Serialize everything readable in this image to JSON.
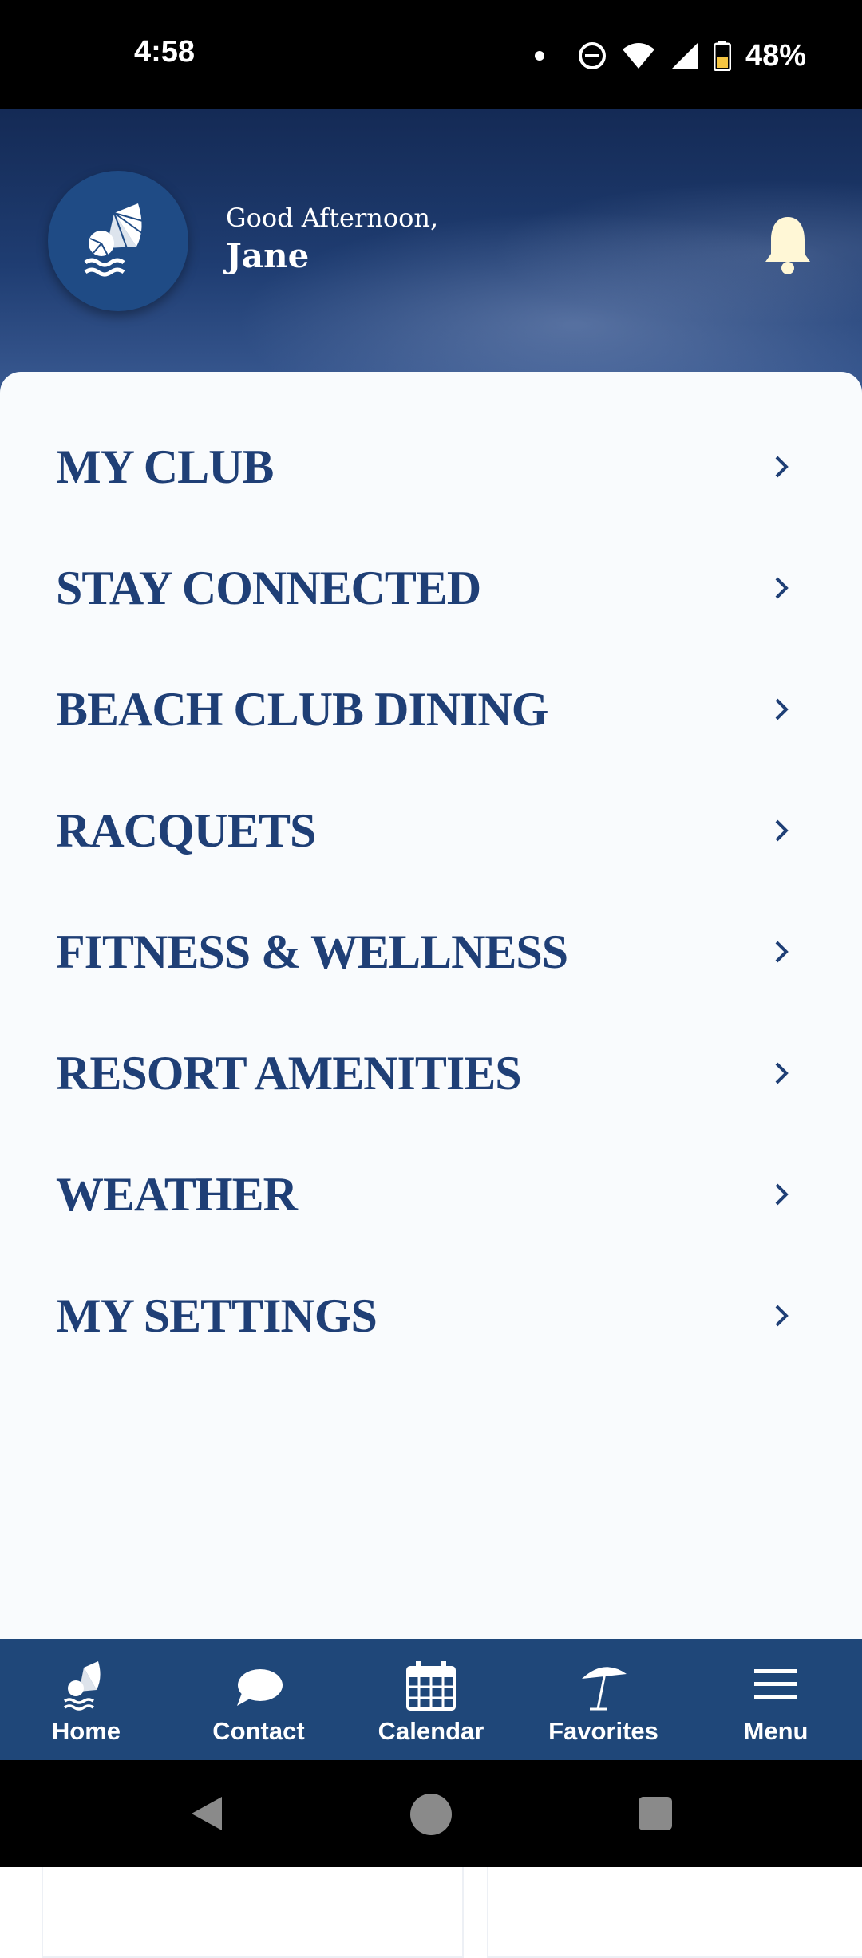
{
  "status_bar": {
    "time": "4:58",
    "battery": "48%"
  },
  "header": {
    "greeting": "Good Afternoon,",
    "user_name": "Jane"
  },
  "menu": {
    "items": [
      {
        "label": "MY CLUB"
      },
      {
        "label": "STAY CONNECTED"
      },
      {
        "label": "BEACH CLUB DINING"
      },
      {
        "label": "RACQUETS"
      },
      {
        "label": "FITNESS & WELLNESS"
      },
      {
        "label": "RESORT AMENITIES"
      },
      {
        "label": "WEATHER"
      },
      {
        "label": "MY SETTINGS"
      }
    ]
  },
  "bottom_nav": {
    "items": [
      {
        "label": "Home",
        "icon": "shell-icon"
      },
      {
        "label": "Contact",
        "icon": "chat-bubble-icon"
      },
      {
        "label": "Calendar",
        "icon": "calendar-icon"
      },
      {
        "label": "Favorites",
        "icon": "umbrella-icon"
      },
      {
        "label": "Menu",
        "icon": "hamburger-icon"
      }
    ]
  },
  "colors": {
    "brand_navy": "#1f3f76",
    "nav_bg": "#1f4779",
    "bell": "#fff7d6"
  }
}
